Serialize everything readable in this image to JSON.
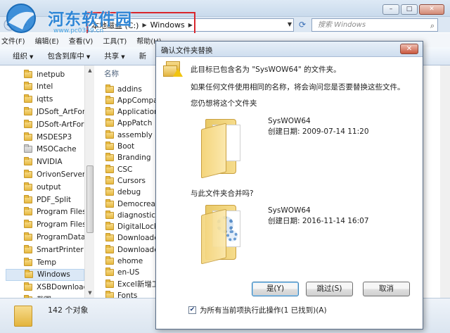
{
  "window": {
    "caption_buttons": [
      "–",
      "□",
      "✕"
    ]
  },
  "watermark": {
    "title": "河东软件园",
    "url": "www.pc0359.cn"
  },
  "address": {
    "crumbs": [
      "本地磁盘 (C:)",
      "Windows"
    ],
    "search_placeholder": "搜索 Windows"
  },
  "menu": [
    "文件(F)",
    "编辑(E)",
    "查看(V)",
    "工具(T)",
    "帮助(H)"
  ],
  "toolbar": {
    "organize": "组织",
    "include": "包含到库中",
    "share": "共享",
    "new": "新"
  },
  "nav_tree": [
    {
      "label": "inetpub"
    },
    {
      "label": "Intel"
    },
    {
      "label": "iqtts"
    },
    {
      "label": "JDSoft_ArtForm"
    },
    {
      "label": "JDSoft-ArtForm"
    },
    {
      "label": "MSDESP3"
    },
    {
      "label": "MSOCache"
    },
    {
      "label": "NVIDIA"
    },
    {
      "label": "OrivonServer"
    },
    {
      "label": "output"
    },
    {
      "label": "PDF_Split"
    },
    {
      "label": "Program Files"
    },
    {
      "label": "Program Files"
    },
    {
      "label": "ProgramData"
    },
    {
      "label": "SmartPrinter"
    },
    {
      "label": "Temp"
    },
    {
      "label": "Windows",
      "selected": true
    },
    {
      "label": "XSBDownload"
    },
    {
      "label": "截图"
    }
  ],
  "file_list": {
    "column_header": "名称",
    "items": [
      "addins",
      "AppCompat",
      "Application",
      "AppPatch",
      "assembly",
      "Boot",
      "Branding",
      "CSC",
      "Cursors",
      "debug",
      "Democreate",
      "diagnostics",
      "DigitalLocke",
      "Downloaded",
      "Downloaded",
      "ehome",
      "en-US",
      "Excel新增工",
      "Fonts"
    ]
  },
  "status": {
    "count": "142 个对象"
  },
  "dialog": {
    "title": "确认文件夹替换",
    "close": "✕",
    "message1": "此目标已包含名为 \"SysWOW64\" 的文件夹。",
    "message2": "如果任何文件使用相同的名称，将会询问您是否要替换这些文件。",
    "prompt_keep": "您仍想将这个文件夹",
    "prompt_merge": "与此文件夹合并吗?",
    "source": {
      "name": "SysWOW64",
      "date": "创建日期: 2009-07-14 11:20"
    },
    "target": {
      "name": "SysWOW64",
      "date": "创建日期: 2016-11-14 16:07"
    },
    "buttons": {
      "yes": "是(Y)",
      "skip": "跳过(S)",
      "cancel": "取消"
    },
    "apply_all": "为所有当前项执行此操作(1 已找到)(A)",
    "apply_all_checked": true
  }
}
